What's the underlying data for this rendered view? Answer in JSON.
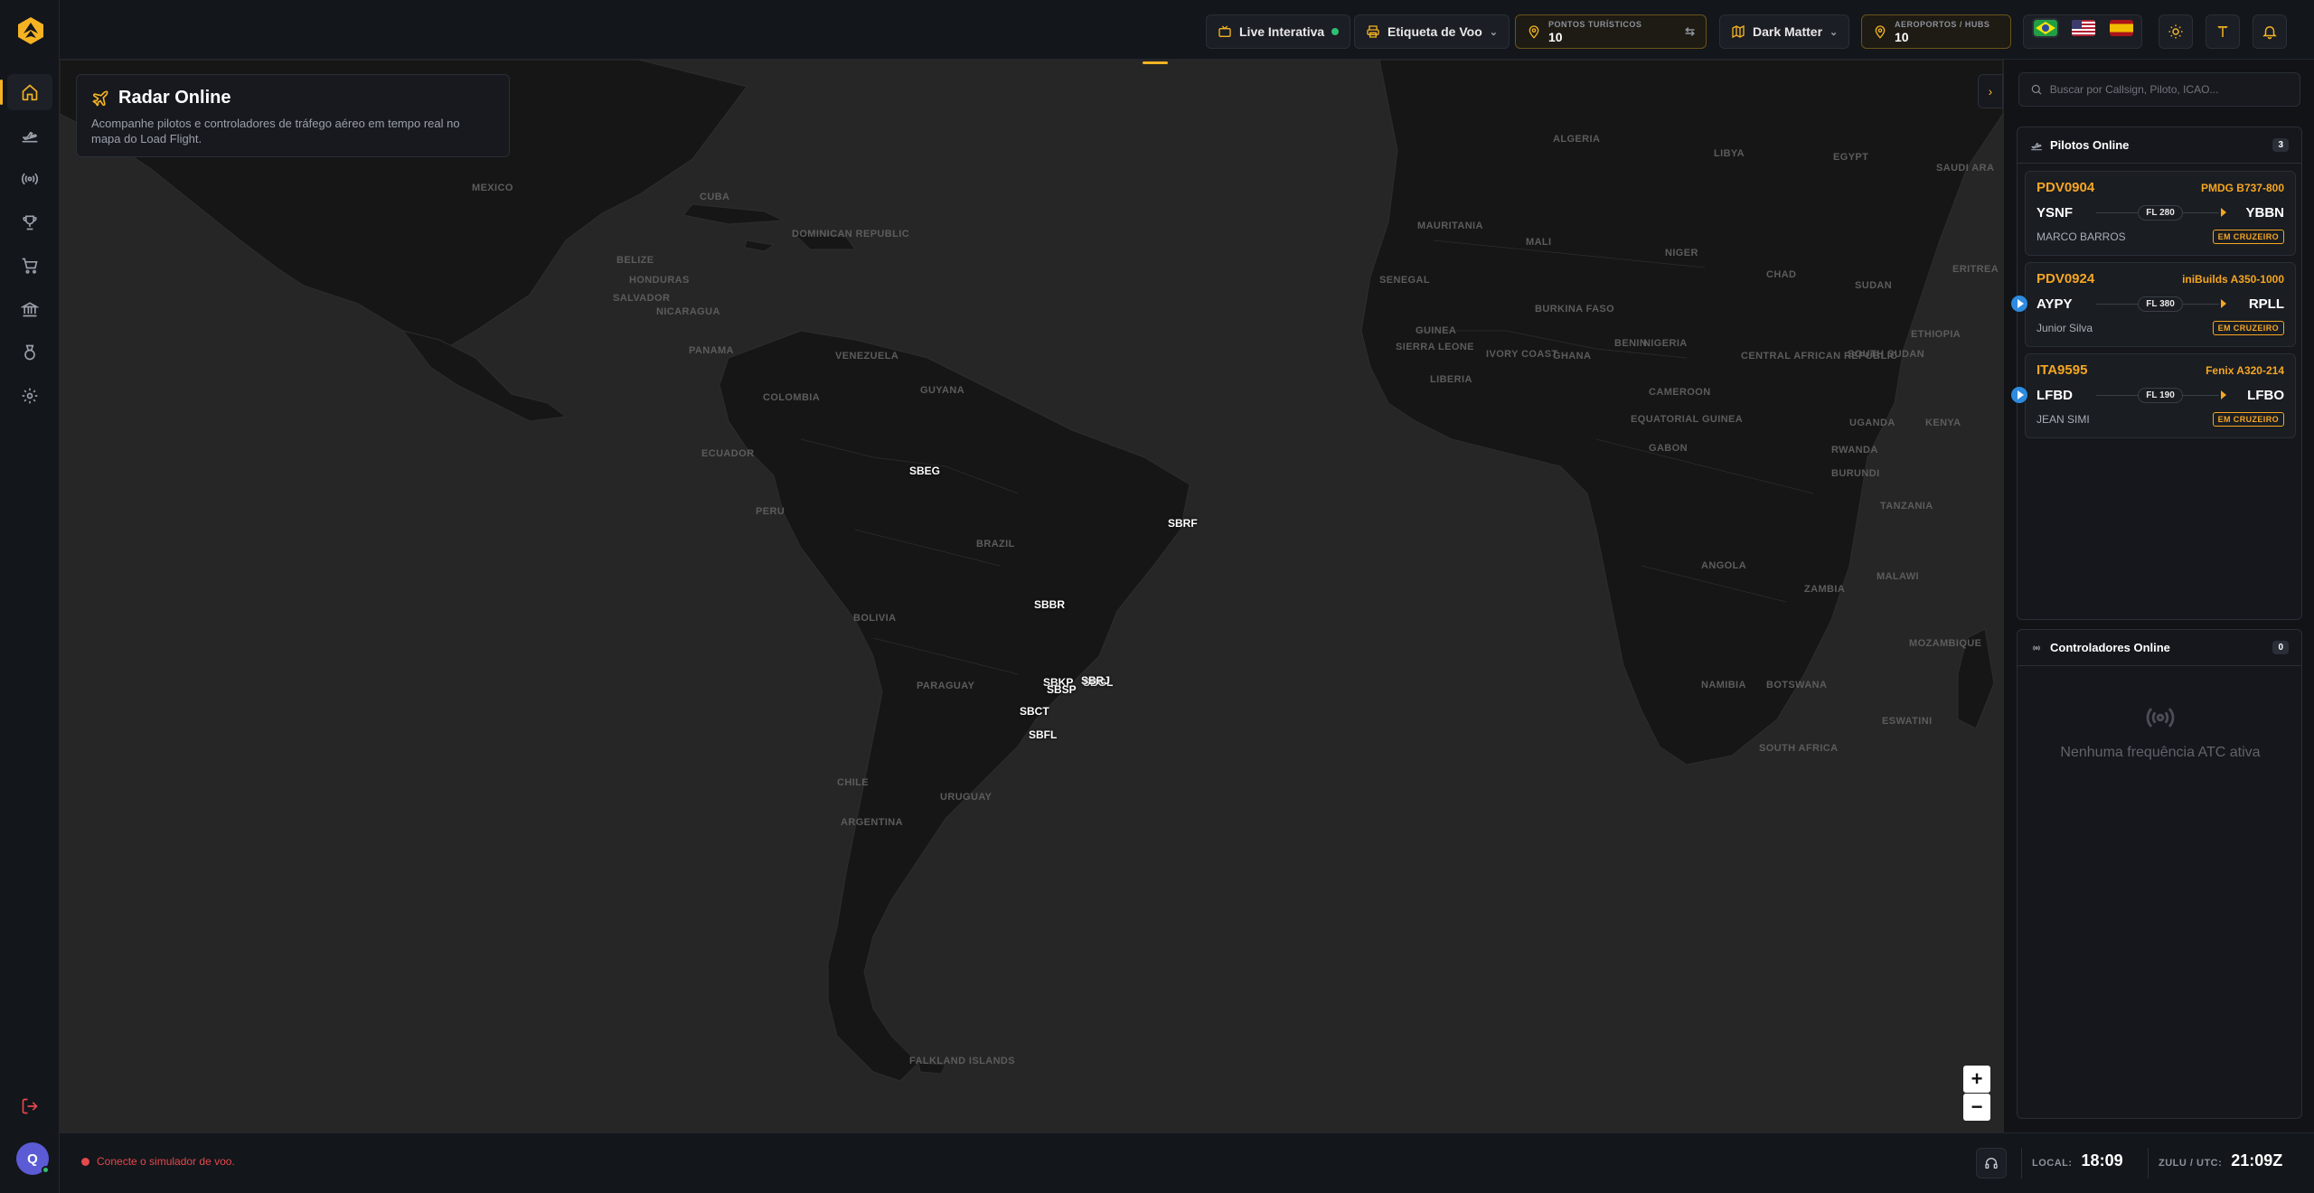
{
  "sidebar": {
    "items": [
      {
        "name": "home-icon"
      },
      {
        "name": "takeoff-icon"
      },
      {
        "name": "radio-icon"
      },
      {
        "name": "trophy-icon"
      },
      {
        "name": "cart-icon"
      },
      {
        "name": "bank-icon"
      },
      {
        "name": "badge-icon"
      },
      {
        "name": "gear-icon"
      }
    ],
    "avatar_initial": "Q"
  },
  "topbar": {
    "live_label": "Live Interativa",
    "flight_label": "Etiqueta de Voo",
    "tourist_label": "PONTOS TURÍSTICOS",
    "tourist_count": "10",
    "theme_label": "Dark Matter",
    "airports_label": "AEROPORTOS / HUBS",
    "airports_count": "10",
    "languages": [
      "pt-BR",
      "en-US",
      "es-ES"
    ]
  },
  "radar": {
    "title": "Radar Online",
    "description": "Acompanhe pilotos e controladores de tráfego aéreo em tempo real no mapa do Load Flight."
  },
  "map": {
    "labels": [
      {
        "text": "MEXICO"
      },
      {
        "text": "CUBA"
      },
      {
        "text": "DOMINICAN REPUBLIC"
      },
      {
        "text": "BELIZE"
      },
      {
        "text": "HONDURAS"
      },
      {
        "text": "SALVADOR"
      },
      {
        "text": "NICARAGUA"
      },
      {
        "text": "PANAMA"
      },
      {
        "text": "VENEZUELA"
      },
      {
        "text": "GUYANA"
      },
      {
        "text": "COLOMBIA"
      },
      {
        "text": "ECUADOR"
      },
      {
        "text": "PERU"
      },
      {
        "text": "BRAZIL"
      },
      {
        "text": "BOLIVIA"
      },
      {
        "text": "PARAGUAY"
      },
      {
        "text": "CHILE"
      },
      {
        "text": "URUGUAY"
      },
      {
        "text": "ARGENTINA"
      },
      {
        "text": "FALKLAND ISLANDS"
      },
      {
        "text": "ALGERIA"
      },
      {
        "text": "LIBYA"
      },
      {
        "text": "EGYPT"
      },
      {
        "text": "SAUDI ARA"
      },
      {
        "text": "MAURITANIA"
      },
      {
        "text": "MALI"
      },
      {
        "text": "NIGER"
      },
      {
        "text": "CHAD"
      },
      {
        "text": "SUDAN"
      },
      {
        "text": "ERITREA"
      },
      {
        "text": "SENEGAL"
      },
      {
        "text": "GUINEA"
      },
      {
        "text": "BURKINA FASO"
      },
      {
        "text": "BENIN"
      },
      {
        "text": "NIGERIA"
      },
      {
        "text": "IVORY COAST"
      },
      {
        "text": "GHANA"
      },
      {
        "text": "LIBERIA"
      },
      {
        "text": "SIERRA LEONE"
      },
      {
        "text": "SOUTH SUDAN"
      },
      {
        "text": "ETHIOPIA"
      },
      {
        "text": "CENTRAL AFRICAN REPUBLIC"
      },
      {
        "text": "CAMEROON"
      },
      {
        "text": "EQUATORIAL GUINEA"
      },
      {
        "text": "GABON"
      },
      {
        "text": "UGANDA"
      },
      {
        "text": "KENYA"
      },
      {
        "text": "RWANDA"
      },
      {
        "text": "BURUNDI"
      },
      {
        "text": "TANZANIA"
      },
      {
        "text": "ANGOLA"
      },
      {
        "text": "ZAMBIA"
      },
      {
        "text": "MALAWI"
      },
      {
        "text": "MOZAMBIQUE"
      },
      {
        "text": "NAMIBIA"
      },
      {
        "text": "BOTSWANA"
      },
      {
        "text": "ESWATINI"
      },
      {
        "text": "SOUTH AFRICA"
      }
    ],
    "airports": [
      {
        "code": "SBEG"
      },
      {
        "code": "SBRF"
      },
      {
        "code": "SBBR"
      },
      {
        "code": "SBKP"
      },
      {
        "code": "SBSP"
      },
      {
        "code": "SBGL"
      },
      {
        "code": "SBRJ"
      },
      {
        "code": "SBCT"
      },
      {
        "code": "SBFL"
      }
    ],
    "zoom_in": "+",
    "zoom_out": "−"
  },
  "panel": {
    "search_placeholder": "Buscar por Callsign, Piloto, ICAO...",
    "pilots_title": "Pilotos Online",
    "pilots_count": "3",
    "pilots": [
      {
        "callsign": "PDV0904",
        "aircraft": "PMDG B737-800",
        "from": "YSNF",
        "to": "YBBN",
        "fl": "FL 280",
        "pilot": "MARCO BARROS",
        "status": "EM CRUZEIRO",
        "playing": false
      },
      {
        "callsign": "PDV0924",
        "aircraft": "iniBuilds A350-1000",
        "from": "AYPY",
        "to": "RPLL",
        "fl": "FL 380",
        "pilot": "Junior Silva",
        "status": "EM CRUZEIRO",
        "playing": true
      },
      {
        "callsign": "ITA9595",
        "aircraft": "Fenix A320-214",
        "from": "LFBD",
        "to": "LFBO",
        "fl": "FL 190",
        "pilot": "JEAN SIMI",
        "status": "EM CRUZEIRO",
        "playing": true
      }
    ],
    "atc_title": "Controladores Online",
    "atc_count": "0",
    "atc_empty": "Nenhuma frequência ATC ativa"
  },
  "bottombar": {
    "sim_status": "Conecte o simulador de voo.",
    "local_label": "LOCAL:",
    "local_time": "18:09",
    "zulu_label": "ZULU / UTC:",
    "zulu_time": "21:09Z"
  },
  "colors": {
    "accent": "#f5b323",
    "callsign": "#f5a623",
    "danger": "#e5484d",
    "online": "#2fbf71",
    "map_sea": "#262626",
    "map_land": "#161616"
  }
}
